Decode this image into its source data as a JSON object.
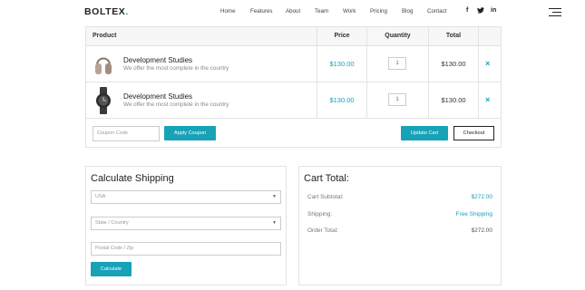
{
  "brand": {
    "name": "BOLTEX",
    "dot": ".",
    "accent": "#17a2b8"
  },
  "nav": {
    "items": [
      "Home",
      "Features",
      "About",
      "Team",
      "Work",
      "Pricing",
      "Blog",
      "Contact"
    ]
  },
  "social": {
    "facebook": "f",
    "twitter": "𝕥",
    "linkedin": "in"
  },
  "cart": {
    "headers": {
      "product": "Product",
      "price": "Price",
      "quantity": "Quantity",
      "total": "Total"
    },
    "rows": [
      {
        "name": "Development Studies",
        "desc": "We offer the most complete in the country",
        "price": "$130.00",
        "qty": "1",
        "total": "$130.00",
        "icon": "headphones-icon"
      },
      {
        "name": "Development Studies",
        "desc": "We offer the most complete in the country",
        "price": "$130.00",
        "qty": "1",
        "total": "$130.00",
        "icon": "watch-icon"
      }
    ],
    "remove_symbol": "×",
    "coupon_placeholder": "Coupon Code",
    "apply_coupon": "Apply Coupon",
    "update_cart": "Update Cart",
    "checkout": "Checkout"
  },
  "shipping": {
    "title": "Calculate Shipping",
    "country": "USA",
    "state_placeholder": "State / Country",
    "postal_placeholder": "Postal Code / Zip",
    "calculate": "Calculate"
  },
  "totals": {
    "title": "Cart Total:",
    "subtotal_label": "Cart Subtotal:",
    "subtotal_value": "$272.00",
    "shipping_label": "Shipping:",
    "shipping_value": "Free Shipping",
    "order_label": "Order Total:",
    "order_value": "$272.00"
  }
}
